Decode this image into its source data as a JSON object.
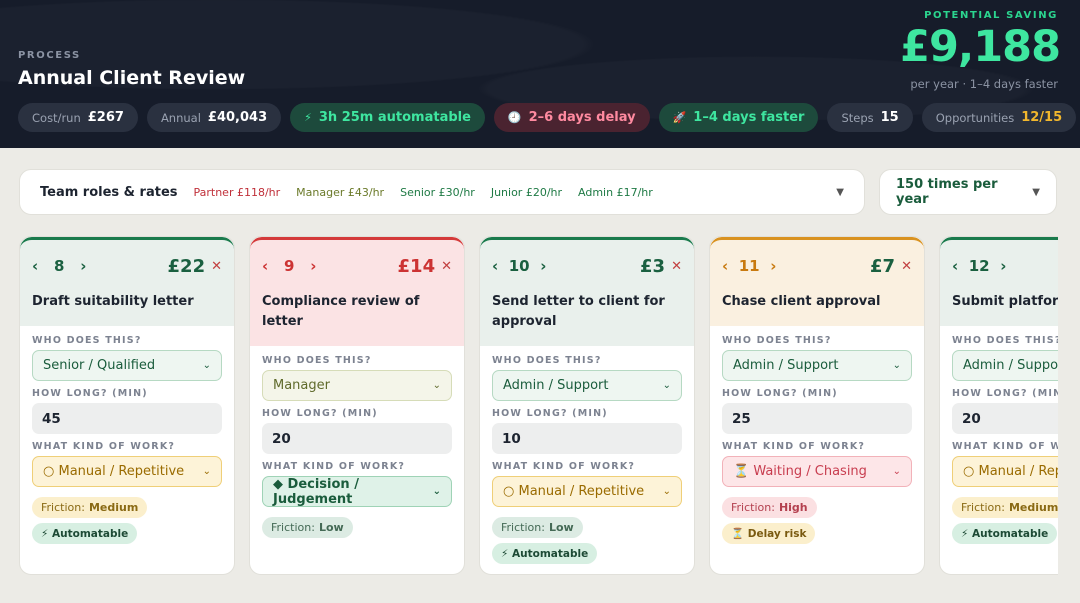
{
  "header": {
    "eyebrow": "PROCESS",
    "title": "Annual Client Review",
    "saving_label": "POTENTIAL SAVING",
    "saving_value": "£9,188",
    "saving_sub": "per year · 1–4 days faster",
    "pills": {
      "cost_label": "Cost/run",
      "cost_value": "£267",
      "annual_label": "Annual",
      "annual_value": "£40,043",
      "automatable": "3h 25m automatable",
      "delay": "2–6 days delay",
      "faster": "1–4 days faster",
      "steps_label": "Steps",
      "steps_value": "15",
      "opps_label": "Opportunities",
      "opps_value": "12/15"
    }
  },
  "rates": {
    "label": "Team roles & rates",
    "items": [
      {
        "text": "Partner £118/hr",
        "color": "#c0303a"
      },
      {
        "text": "Manager £43/hr",
        "color": "#6b7a2a"
      },
      {
        "text": "Senior £30/hr",
        "color": "#1f7a45"
      },
      {
        "text": "Junior £20/hr",
        "color": "#1f7a45"
      },
      {
        "text": "Admin £17/hr",
        "color": "#1f7a45"
      }
    ]
  },
  "frequency": "150 times per year",
  "labels": {
    "who": "WHO DOES THIS?",
    "how_long": "HOW LONG? (MIN)",
    "kind": "WHAT KIND OF WORK?",
    "friction": "Friction:",
    "automatable": "⚡ Automatable",
    "delay_risk": "⏳ Delay risk"
  },
  "cards": [
    {
      "num": "8",
      "cost": "£22",
      "title": "Draft suitability letter",
      "who": "Senior / Qualified",
      "minutes": "45",
      "kind": "○ Manual / Repetitive",
      "friction": "Medium"
    },
    {
      "num": "9",
      "cost": "£14",
      "title": "Compliance review of letter",
      "who": "Manager",
      "minutes": "20",
      "kind": "◆ Decision / Judgement",
      "friction": "Low"
    },
    {
      "num": "10",
      "cost": "£3",
      "title": "Send letter to client for approval",
      "who": "Admin / Support",
      "minutes": "10",
      "kind": "○ Manual / Repetitive",
      "friction": "Low"
    },
    {
      "num": "11",
      "cost": "£7",
      "title": "Chase client approval",
      "who": "Admin / Support",
      "minutes": "25",
      "kind": "⏳ Waiting / Chasing",
      "friction": "High"
    },
    {
      "num": "12",
      "cost": "",
      "title": "Submit platform",
      "who": "Admin / Support",
      "minutes": "20",
      "kind": "○ Manual / Repetitive",
      "friction": "Medium"
    }
  ],
  "icons": {
    "prev": "chevron-left-icon",
    "next": "chevron-right-icon",
    "remove": "close-icon",
    "dropdown": "chevron-down-icon"
  }
}
